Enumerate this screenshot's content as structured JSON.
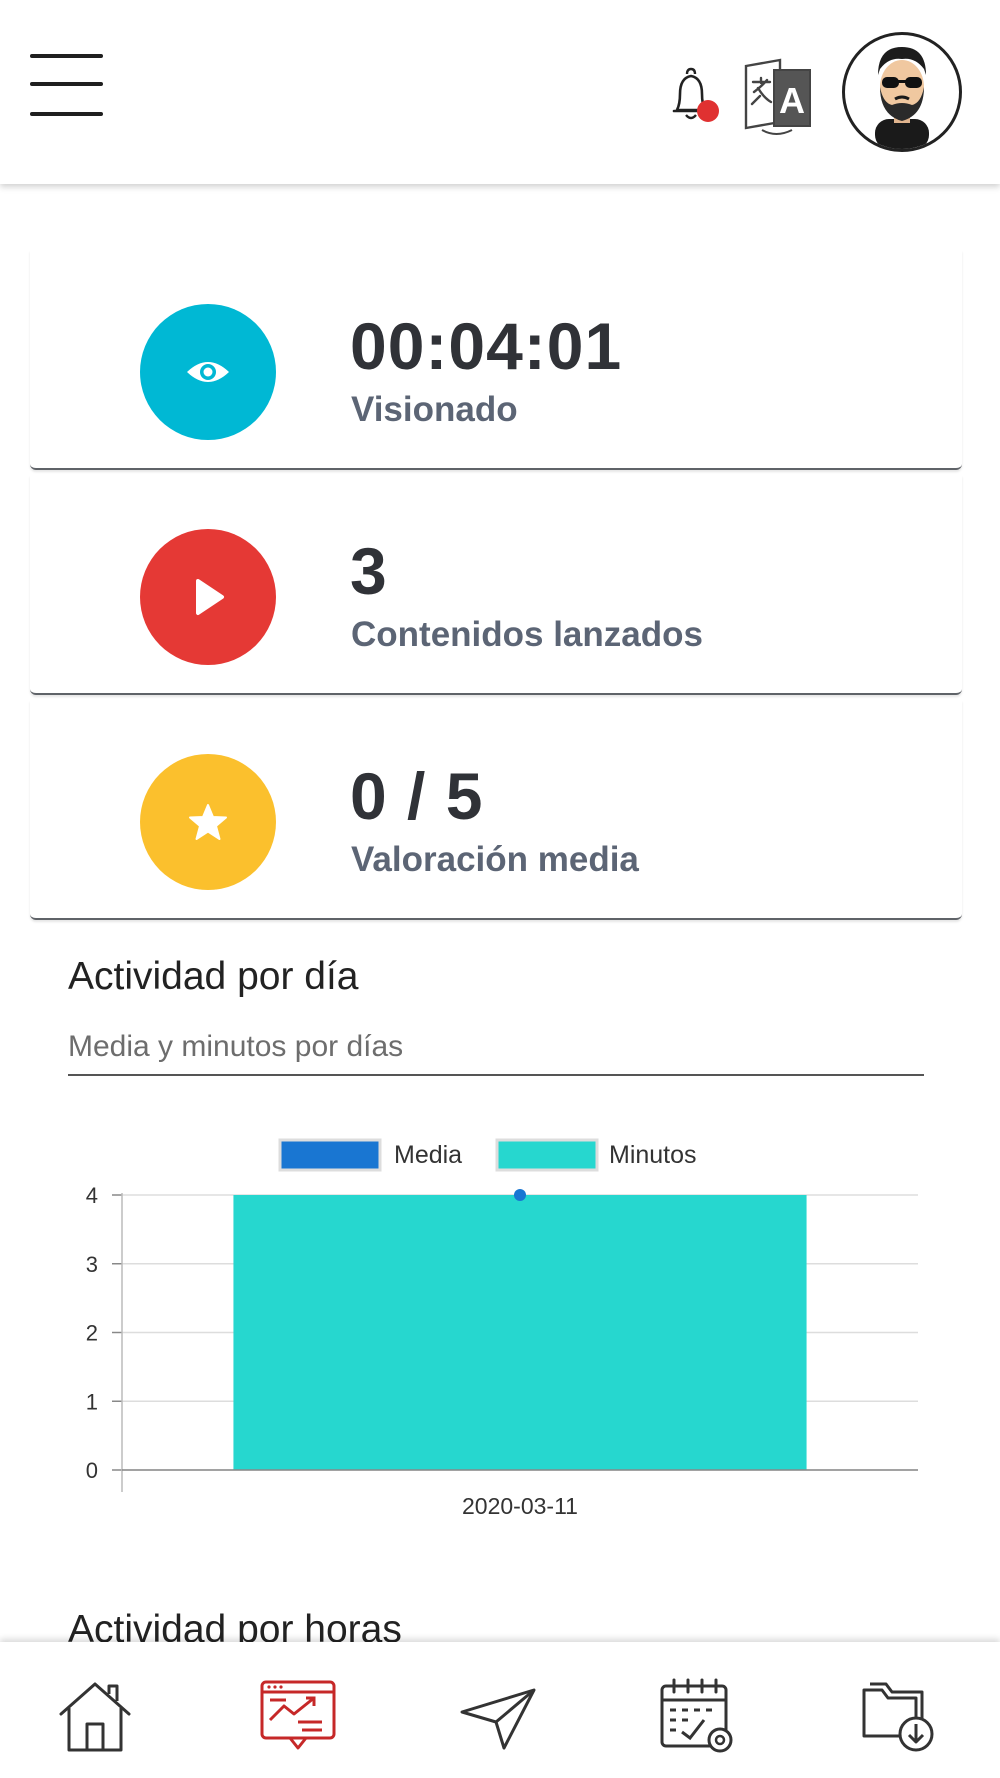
{
  "header": {
    "menu_icon": "hamburger-menu-icon",
    "notification_icon": "bell-icon",
    "notification_badge_color": "#e03131",
    "translate_icon": "translate-icon",
    "avatar": "user-avatar"
  },
  "stats": [
    {
      "value": "00:04:01",
      "label": "Visionado",
      "icon": "eye-icon",
      "color": "#00b8d4"
    },
    {
      "value": "3",
      "label": "Contenidos lanzados",
      "icon": "play-icon",
      "color": "#e53935"
    },
    {
      "value": "0 / 5",
      "label": "Valoración media",
      "icon": "star-icon",
      "color": "#fbc02d"
    }
  ],
  "activity_day": {
    "title": "Actividad por día",
    "subtitle": "Media y minutos por días"
  },
  "chart_data": {
    "type": "bar",
    "categories": [
      "2020-03-11"
    ],
    "series": [
      {
        "name": "Media",
        "type": "line",
        "values": [
          4
        ],
        "color": "#1976d2"
      },
      {
        "name": "Minutos",
        "type": "bar",
        "values": [
          4
        ],
        "color": "#26d7cf"
      }
    ],
    "ylim": [
      0,
      4
    ],
    "yticks": [
      "0",
      "1",
      "2",
      "3",
      "4"
    ],
    "grid": true,
    "legend": "top-center"
  },
  "activity_hours": {
    "title": "Actividad por horas"
  },
  "bottom_nav": [
    {
      "icon": "home-icon"
    },
    {
      "icon": "statistics-icon",
      "active_color": "#c62828"
    },
    {
      "icon": "send-icon"
    },
    {
      "icon": "calendar-icon"
    },
    {
      "icon": "downloads-folder-icon"
    }
  ]
}
